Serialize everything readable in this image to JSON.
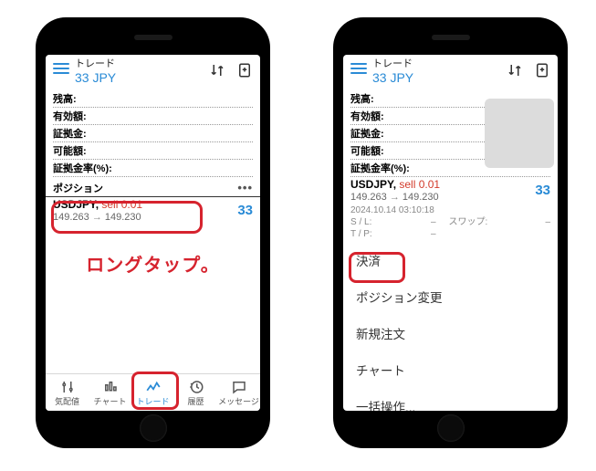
{
  "header": {
    "title_small": "トレード",
    "title_big": "33 JPY"
  },
  "account": {
    "rows": [
      {
        "label": "残高:"
      },
      {
        "label": "有効額:"
      },
      {
        "label": "証拠金:"
      },
      {
        "label": "可能額:"
      },
      {
        "label": "証拠金率(%):"
      }
    ],
    "section_label": "ポジション"
  },
  "position": {
    "symbol": "USDJPY,",
    "side": "sell 0.01",
    "price_from": "149.263",
    "price_to": "149.230",
    "pl": "33"
  },
  "callout": "ロングタップ。",
  "tabs": {
    "items": [
      {
        "label": "気配値"
      },
      {
        "label": "チャート"
      },
      {
        "label": "トレード"
      },
      {
        "label": "履歴"
      },
      {
        "label": "メッセージ"
      }
    ],
    "active_index": 2
  },
  "detail": {
    "timestamp": "2024.10.14 03:10:18",
    "sl_label": "S / L:",
    "tp_label": "T / P:",
    "swap_label": "スワップ:",
    "dash": "–"
  },
  "menu": {
    "items": [
      {
        "label": "決済"
      },
      {
        "label": "ポジション変更"
      },
      {
        "label": "新規注文"
      },
      {
        "label": "チャート"
      },
      {
        "label": "一括操作..."
      }
    ]
  }
}
